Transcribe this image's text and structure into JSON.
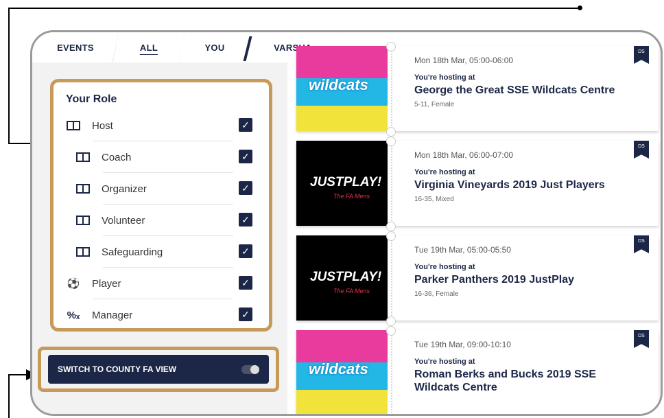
{
  "tabs": [
    {
      "label": "EVENTS"
    },
    {
      "label": "ALL"
    },
    {
      "label": "YOU"
    },
    {
      "label": "VARSHA"
    }
  ],
  "role_panel": {
    "title": "Your Role",
    "roles": [
      {
        "label": "Host",
        "icon": "pitch-icon",
        "checked": true
      },
      {
        "label": "Coach",
        "icon": "pitch-icon",
        "checked": true
      },
      {
        "label": "Organizer",
        "icon": "pitch-icon",
        "checked": true
      },
      {
        "label": "Volunteer",
        "icon": "pitch-icon",
        "checked": true
      },
      {
        "label": "Safeguarding",
        "icon": "pitch-icon",
        "checked": true
      },
      {
        "label": "Player",
        "icon": "football-icon",
        "checked": true
      },
      {
        "label": "Manager",
        "icon": "tactics-icon",
        "checked": true
      }
    ]
  },
  "switch": {
    "label": "SWITCH TO COUNTY FA VIEW",
    "on": false
  },
  "events": [
    {
      "date": "Mon 18th Mar, 05:00-06:00",
      "hosting": "You're hosting at",
      "name": "George the Great SSE Wildcats Centre",
      "meta": "5-11, Female",
      "logo": "wildcats",
      "logo_text": "wildcats"
    },
    {
      "date": "Mon 18th Mar, 06:00-07:00",
      "hosting": "You're hosting at",
      "name": "Virginia Vineyards 2019 Just Players",
      "meta": "16-35, Mixed",
      "logo": "justplay",
      "logo_text": "JUSTPLAY!",
      "logo_sub": "The FA Mens"
    },
    {
      "date": "Tue 19th Mar, 05:00-05:50",
      "hosting": "You're hosting at",
      "name": "Parker Panthers 2019 JustPlay",
      "meta": "16-36, Female",
      "logo": "justplay",
      "logo_text": "JUSTPLAY!",
      "logo_sub": "The FA Mens"
    },
    {
      "date": "Tue 19th Mar, 09:00-10:10",
      "hosting": "You're hosting at",
      "name": "Roman Berks and Bucks 2019 SSE Wildcats Centre",
      "meta": "",
      "logo": "wildcats",
      "logo_text": "wildcats"
    }
  ],
  "colors": {
    "navy": "#1c2747",
    "highlight": "#c89a5a"
  }
}
